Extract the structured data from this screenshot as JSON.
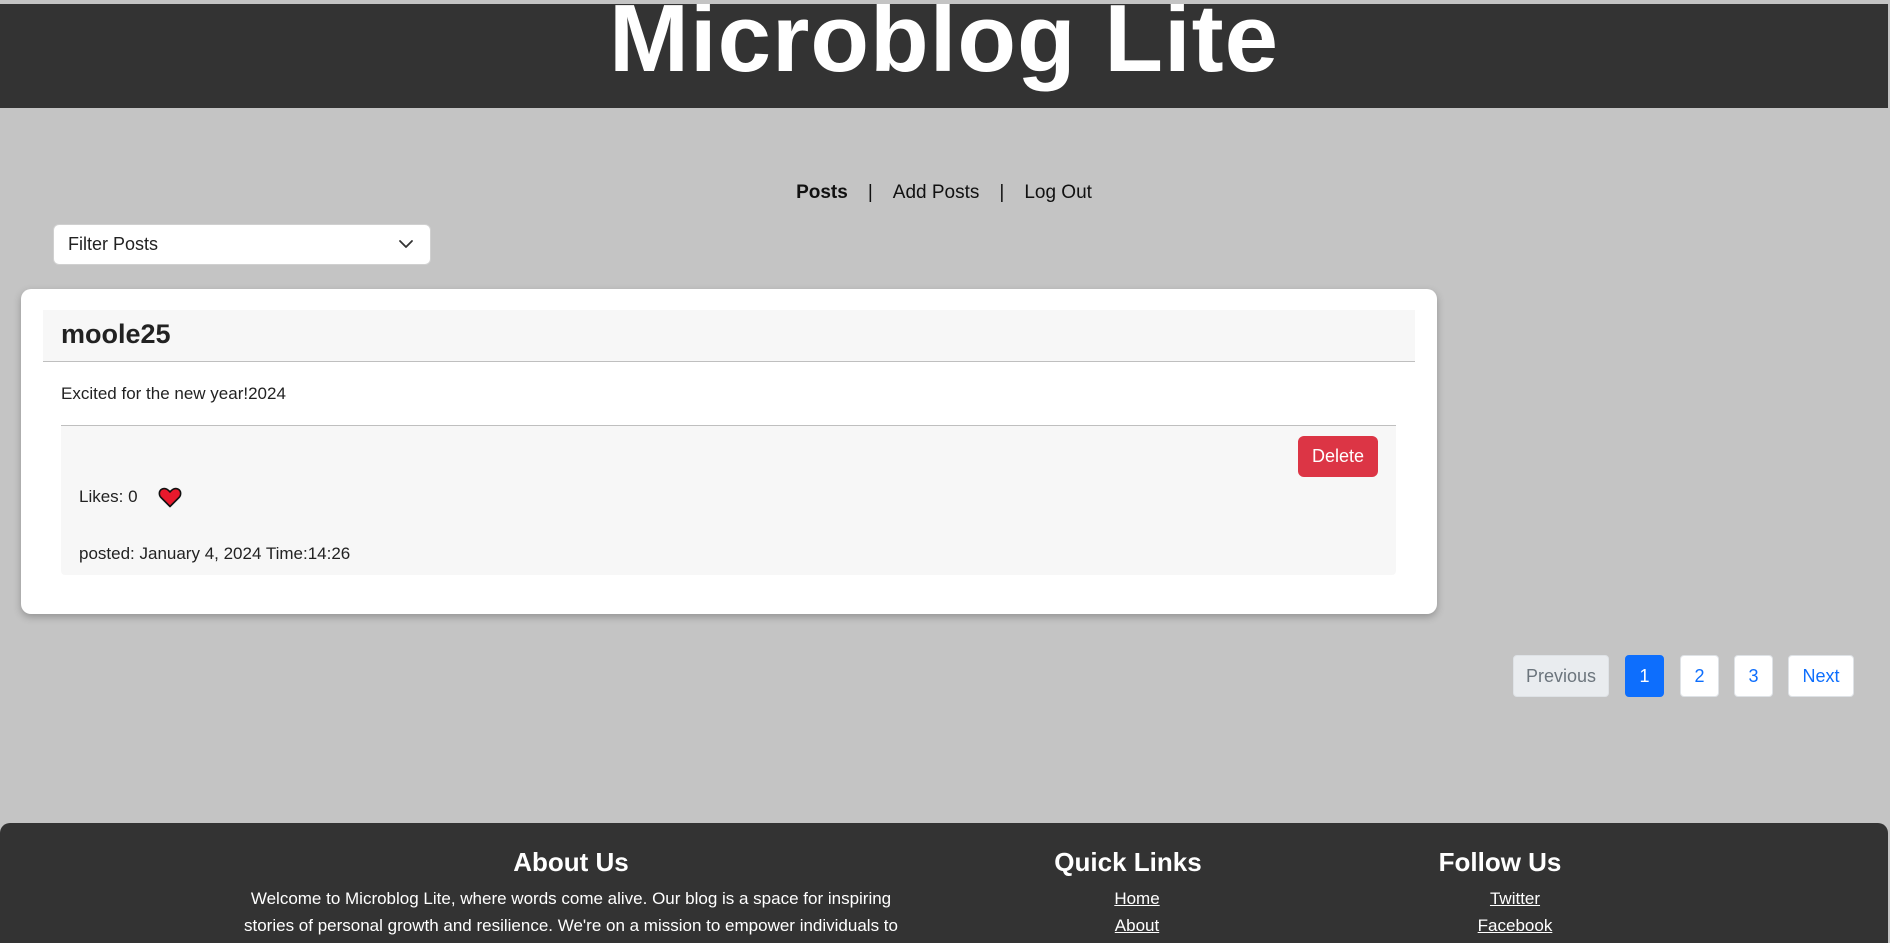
{
  "header": {
    "title": "Microblog Lite"
  },
  "nav": {
    "items": [
      {
        "label": "Posts",
        "active": true
      },
      {
        "label": "Add Posts",
        "active": false
      },
      {
        "label": "Log Out",
        "active": false
      }
    ],
    "separator": "|"
  },
  "filter": {
    "selected": "Filter Posts"
  },
  "post": {
    "username": "moole25",
    "text": "Excited for the new year!2024",
    "delete_label": "Delete",
    "likes_label": "Likes: 0",
    "posted": "posted: January 4, 2024 Time:14:26",
    "heart_color": "#e8192c"
  },
  "pagination": {
    "previous": "Previous",
    "pages": [
      "1",
      "2",
      "3"
    ],
    "current": "1",
    "next": "Next"
  },
  "footer": {
    "about": {
      "heading": "About Us",
      "text_line1": "Welcome to Microblog Lite, where words come alive. Our blog is a space for inspiring",
      "text_line2": "stories of personal growth and resilience. We're on a mission to empower individuals to"
    },
    "quick_links": {
      "heading": "Quick Links",
      "links": [
        "Home",
        "About"
      ]
    },
    "follow": {
      "heading": "Follow Us",
      "links": [
        "Twitter",
        "Facebook"
      ]
    }
  },
  "colors": {
    "header_bg": "#333333",
    "page_bg": "#c4c4c4",
    "danger": "#dc3545",
    "primary": "#0d6efd"
  }
}
